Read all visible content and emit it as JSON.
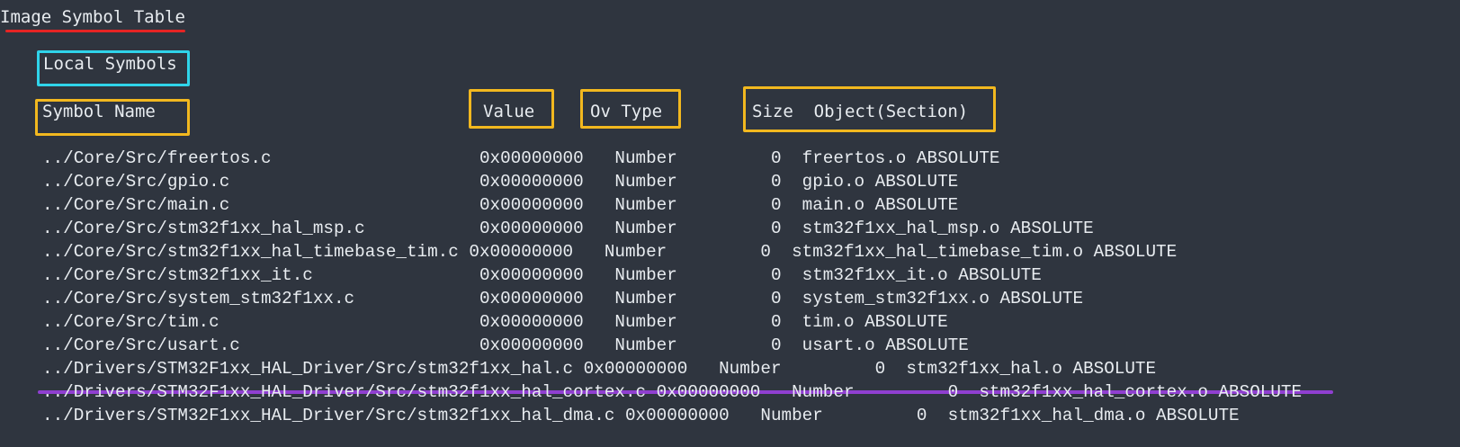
{
  "title": "Image Symbol Table",
  "section": "Local Symbols",
  "headers": {
    "symbol_name": "Symbol Name",
    "value": "Value",
    "ov_type": "Ov Type",
    "size_object": "Size  Object(Section)"
  },
  "rows": [
    "../Core/Src/freertos.c                    0x00000000   Number         0  freertos.o ABSOLUTE",
    "../Core/Src/gpio.c                        0x00000000   Number         0  gpio.o ABSOLUTE",
    "../Core/Src/main.c                        0x00000000   Number         0  main.o ABSOLUTE",
    "../Core/Src/stm32f1xx_hal_msp.c           0x00000000   Number         0  stm32f1xx_hal_msp.o ABSOLUTE",
    "../Core/Src/stm32f1xx_hal_timebase_tim.c 0x00000000   Number         0  stm32f1xx_hal_timebase_tim.o ABSOLUTE",
    "../Core/Src/stm32f1xx_it.c                0x00000000   Number         0  stm32f1xx_it.o ABSOLUTE",
    "../Core/Src/system_stm32f1xx.c            0x00000000   Number         0  system_stm32f1xx.o ABSOLUTE",
    "../Core/Src/tim.c                         0x00000000   Number         0  tim.o ABSOLUTE",
    "../Core/Src/usart.c                       0x00000000   Number         0  usart.o ABSOLUTE",
    "../Drivers/STM32F1xx_HAL_Driver/Src/stm32f1xx_hal.c 0x00000000   Number         0  stm32f1xx_hal.o ABSOLUTE",
    "../Drivers/STM32F1xx_HAL_Driver/Src/stm32f1xx_hal_cortex.c 0x00000000   Number         0  stm32f1xx_hal_cortex.o ABSOLUTE",
    "../Drivers/STM32F1xx_HAL_Driver/Src/stm32f1xx_hal_dma.c 0x00000000   Number         0  stm32f1xx_hal_dma.o ABSOLUTE"
  ],
  "colors": {
    "background": "#2f353f",
    "text": "#e8ecf0",
    "title_underline": "#e62424",
    "section_box": "#2fd4ea",
    "header_box": "#f2b81f",
    "row_underline": "#8f3fd0"
  }
}
